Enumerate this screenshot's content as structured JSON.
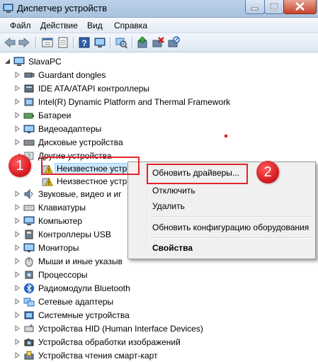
{
  "window": {
    "title": "Диспетчер устройств",
    "icon": "device-manager-icon"
  },
  "menu": [
    "Файл",
    "Действие",
    "Вид",
    "Справка"
  ],
  "toolbar": [
    "back-arrow-icon",
    "forward-arrow-icon",
    "properties-icon",
    "show-hidden-icon",
    "help-icon",
    "computer-icon",
    "scan-hardware-icon",
    "update-driver-icon",
    "uninstall-icon",
    "disable-icon"
  ],
  "tree": {
    "root": "SlavaPC",
    "items": [
      "Guardant dongles",
      "IDE ATA/ATAPI контроллеры",
      "Intel(R) Dynamic Platform and Thermal Framework",
      "Батареи",
      "Видеоадаптеры",
      "Дисковые устройства",
      "Другие устройства",
      "Неизвестное устр",
      "Неизвестное устр",
      "Звуковые, видео и иг",
      "Клавиатуры",
      "Компьютер",
      "Контроллеры USB",
      "Мониторы",
      "Мыши и иные указыв",
      "Процессоры",
      "Радиомодули Bluetooth",
      "Сетевые адаптеры",
      "Системные устройства",
      "Устройства HID (Human Interface Devices)",
      "Устройства обработки изображений",
      "Устройства чтения смарт-карт"
    ]
  },
  "context_menu": {
    "update_drivers": "Обновить драйверы...",
    "disable": "Отключить",
    "delete": "Удалить",
    "scan": "Обновить конфигурацию оборудования",
    "properties": "Свойства"
  },
  "annotations": {
    "step1": "1",
    "step2": "2",
    "color": "#e4232a"
  }
}
